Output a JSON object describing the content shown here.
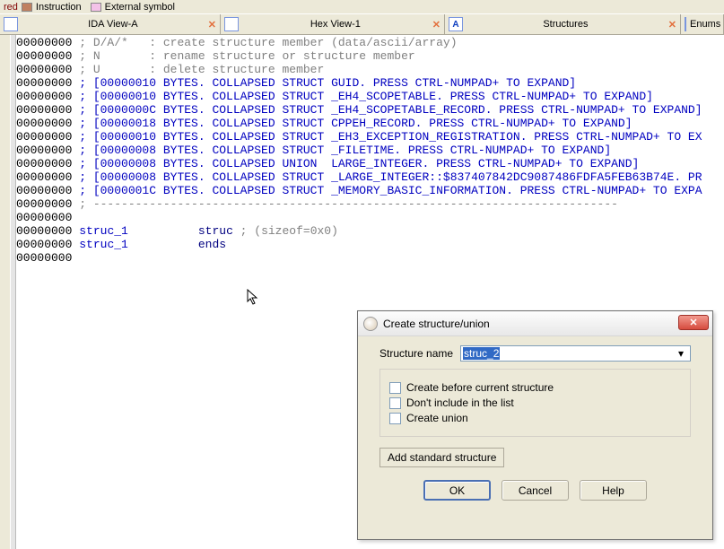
{
  "legend": {
    "red_label": "red",
    "instruction": "Instruction",
    "extsym": "External symbol"
  },
  "tabs": {
    "ida_view": "IDA View-A",
    "hex_view": "Hex View-1",
    "structures": "Structures",
    "enums": "Enums",
    "close_glyph": "✕",
    "struct_glyph": "A"
  },
  "lines": [
    {
      "addr": "00000000",
      "t": " ; D/A/*   : create structure member (data/ascii/array)",
      "cls": "grey"
    },
    {
      "addr": "00000000",
      "t": " ; N       : rename structure or structure member",
      "cls": "grey"
    },
    {
      "addr": "00000000",
      "t": " ; U       : delete structure member",
      "cls": "grey"
    },
    {
      "addr": "00000000",
      "t": " ; [00000010 BYTES. COLLAPSED STRUCT GUID. PRESS CTRL-NUMPAD+ TO EXPAND]",
      "cls": "blue"
    },
    {
      "addr": "00000000",
      "t": " ; [00000010 BYTES. COLLAPSED STRUCT _EH4_SCOPETABLE. PRESS CTRL-NUMPAD+ TO EXPAND]",
      "cls": "blue"
    },
    {
      "addr": "00000000",
      "t": " ; [0000000C BYTES. COLLAPSED STRUCT _EH4_SCOPETABLE_RECORD. PRESS CTRL-NUMPAD+ TO EXPAND]",
      "cls": "blue"
    },
    {
      "addr": "00000000",
      "t": " ; [00000018 BYTES. COLLAPSED STRUCT CPPEH_RECORD. PRESS CTRL-NUMPAD+ TO EXPAND]",
      "cls": "blue"
    },
    {
      "addr": "00000000",
      "t": " ; [00000010 BYTES. COLLAPSED STRUCT _EH3_EXCEPTION_REGISTRATION. PRESS CTRL-NUMPAD+ TO EX",
      "cls": "blue"
    },
    {
      "addr": "00000000",
      "t": " ; [00000008 BYTES. COLLAPSED STRUCT _FILETIME. PRESS CTRL-NUMPAD+ TO EXPAND]",
      "cls": "blue"
    },
    {
      "addr": "00000000",
      "t": " ; [00000008 BYTES. COLLAPSED UNION  LARGE_INTEGER. PRESS CTRL-NUMPAD+ TO EXPAND]",
      "cls": "blue"
    },
    {
      "addr": "00000000",
      "t": " ; [00000008 BYTES. COLLAPSED STRUCT _LARGE_INTEGER::$837407842DC9087486FDFA5FEB63B74E. PR",
      "cls": "blue"
    },
    {
      "addr": "00000000",
      "t": " ; [0000001C BYTES. COLLAPSED STRUCT _MEMORY_BASIC_INFORMATION. PRESS CTRL-NUMPAD+ TO EXPA",
      "cls": "blue"
    },
    {
      "addr": "00000000",
      "t": " ; ---------------------------------------------------------------------------",
      "cls": "grey"
    },
    {
      "addr": "00000000",
      "t": "",
      "cls": "grey"
    }
  ],
  "struct_rows": [
    {
      "addr": "00000000",
      "name": "struc_1",
      "kw": "struc",
      "rest": " ; (sizeof=0x0)"
    },
    {
      "addr": "00000000",
      "name": "struc_1",
      "kw": "ends",
      "rest": ""
    }
  ],
  "tail_addr": "00000000",
  "dialog": {
    "title": "Create structure/union",
    "name_label": "Structure name",
    "name_value": "struc_2",
    "cb_before": "Create before current structure",
    "cb_nolist": "Don't include in the list",
    "cb_union": "Create union",
    "add_std": "Add standard structure",
    "ok": "OK",
    "cancel": "Cancel",
    "help": "Help"
  }
}
